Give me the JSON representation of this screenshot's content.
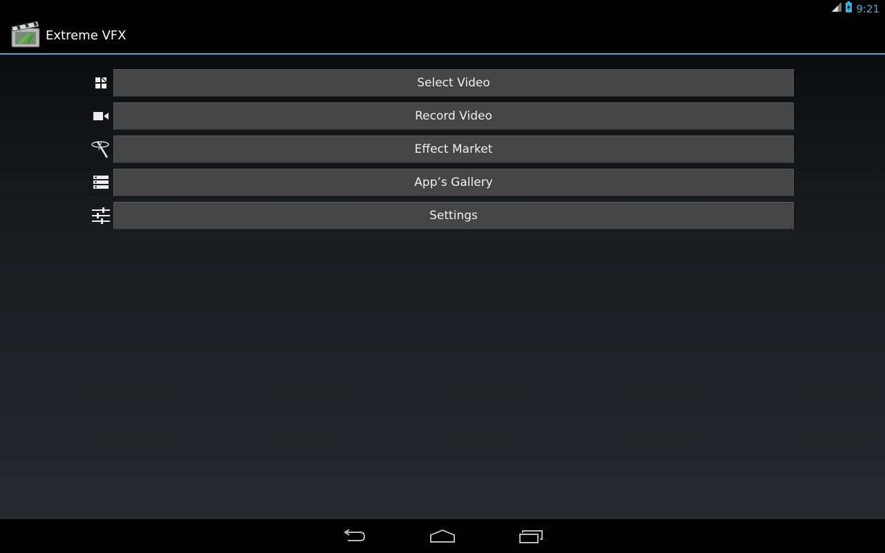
{
  "status": {
    "time": "9:21",
    "signal_icon": "signal-icon",
    "battery_icon": "battery-charging-icon",
    "accent": "#33b5e5"
  },
  "app": {
    "title": "Extreme VFX",
    "icon": "app-logo-clapperboard-icon"
  },
  "menu": [
    {
      "id": "select-video",
      "label": "Select Video",
      "icon": "grid-icon"
    },
    {
      "id": "record-video",
      "label": "Record Video",
      "icon": "video-camera-icon"
    },
    {
      "id": "effect-market",
      "label": "Effect Market",
      "icon": "magic-wand-icon"
    },
    {
      "id": "apps-gallery",
      "label": "App’s Gallery",
      "icon": "list-icon"
    },
    {
      "id": "settings",
      "label": "Settings",
      "icon": "sliders-icon"
    }
  ],
  "nav": {
    "back_icon": "back-icon",
    "home_icon": "home-icon",
    "recents_icon": "recents-icon"
  }
}
